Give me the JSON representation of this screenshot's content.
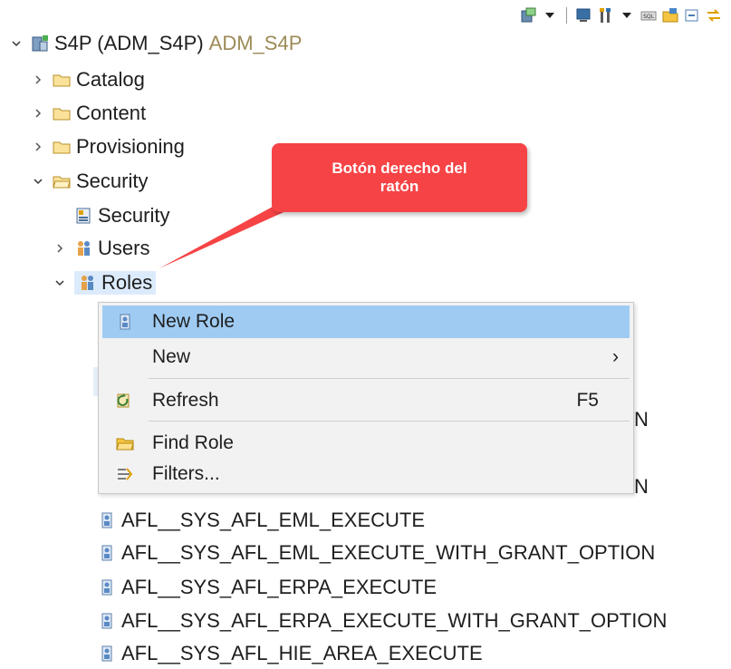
{
  "toolbar": {
    "icons": [
      "new-connection-icon",
      "dropdown-caret-icon",
      "console-icon",
      "tools-icon",
      "dropdown-caret-icon",
      "sql-icon",
      "open-folder-icon",
      "collapse-all-icon",
      "link-icon"
    ]
  },
  "tree": {
    "root_label": "S4P (ADM_S4P)",
    "root_user": "ADM_S4P",
    "catalog": "Catalog",
    "content": "Content",
    "provisioning": "Provisioning",
    "security_folder": "Security",
    "security_item": "Security",
    "users": "Users",
    "roles": "Roles",
    "role_items": [
      "AFL__SYS_AFL_EML_EXECUTE",
      "AFL__SYS_AFL_EML_EXECUTE_WITH_GRANT_OPTION",
      "AFL__SYS_AFL_ERPA_EXECUTE",
      "AFL__SYS_AFL_ERPA_EXECUTE_WITH_GRANT_OPTION",
      "AFL__SYS_AFL_HIE_AREA_EXECUTE"
    ],
    "obscured_edge_1": "N",
    "obscured_edge_2": "N"
  },
  "callout": {
    "text_line1": "Botón derecho del",
    "text_line2": "ratón"
  },
  "context_menu": {
    "new_role": "New Role",
    "new": "New",
    "new_arrow": "›",
    "refresh": "Refresh",
    "refresh_shortcut": "F5",
    "find_role": "Find Role",
    "filters": "Filters..."
  },
  "colors": {
    "callout_bg": "#f64345",
    "menu_highlight": "#9fcbf3",
    "selection": "#dcebfc",
    "muted_text": "#9c8a57"
  }
}
